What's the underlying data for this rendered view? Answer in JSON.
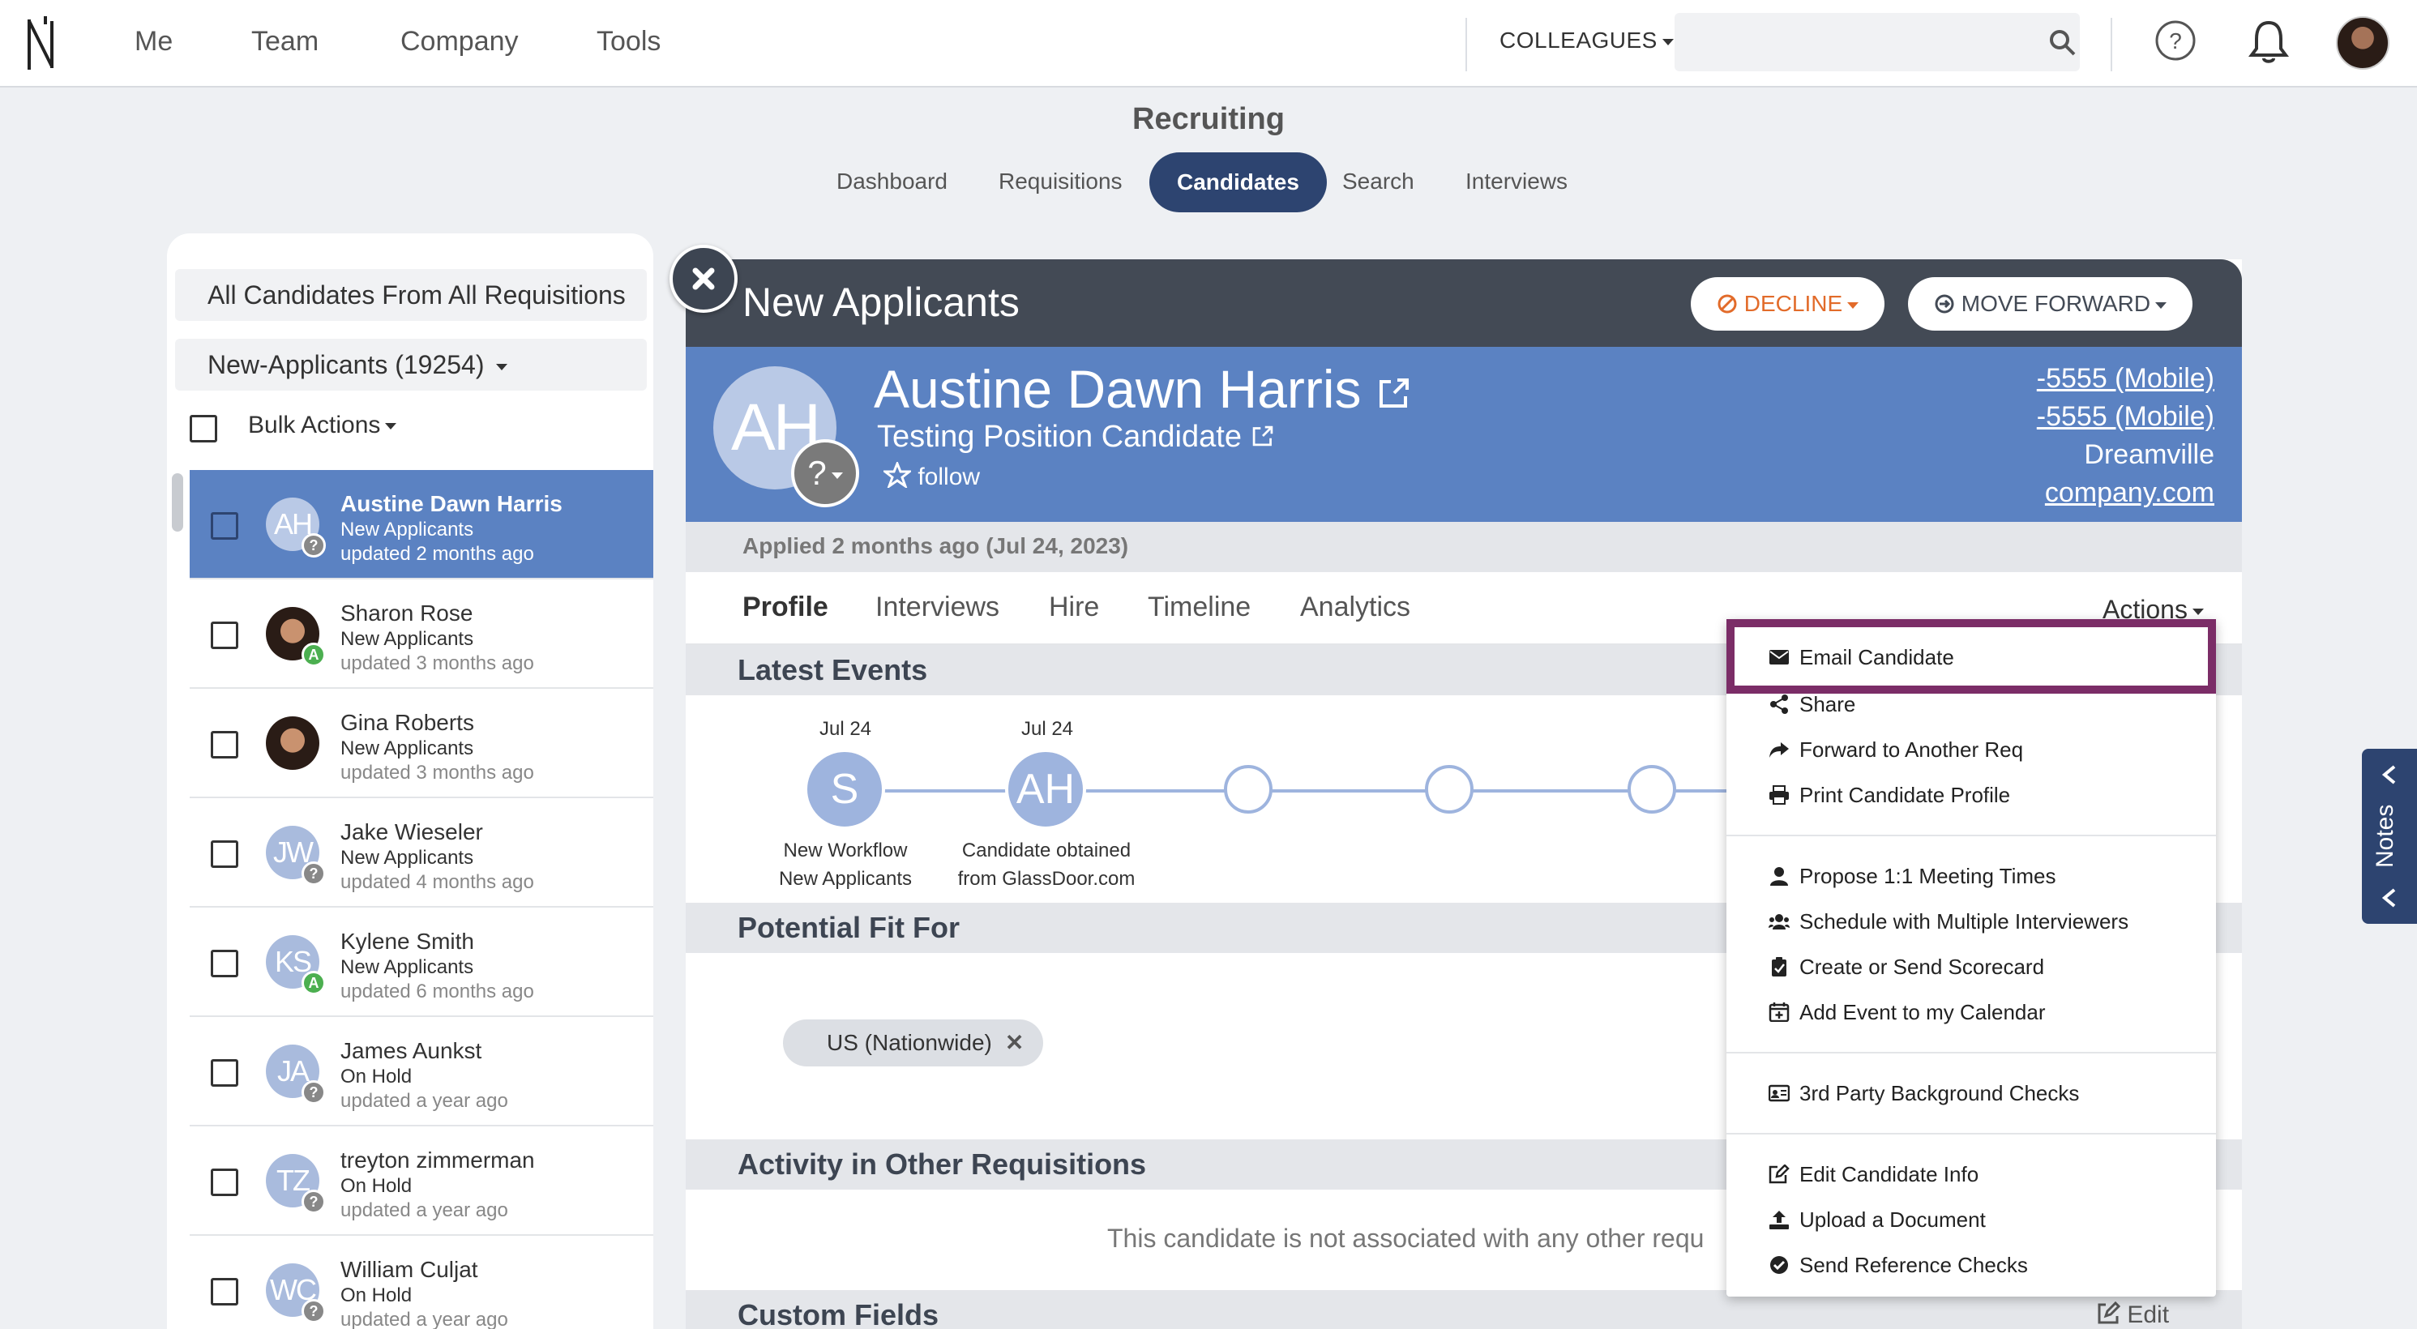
{
  "topnav": {
    "items": [
      "Me",
      "Team",
      "Company",
      "Tools"
    ],
    "colleagues_label": "COLLEAGUES",
    "search_placeholder": ""
  },
  "recruiting": {
    "title": "Recruiting",
    "tabs": [
      "Dashboard",
      "Requisitions",
      "Candidates",
      "Search",
      "Interviews"
    ],
    "active_tab": "Candidates"
  },
  "left": {
    "filter_scope": "All Candidates From All Requisitions",
    "filter_stage": "New-Applicants (19254)",
    "bulk_actions": "Bulk Actions",
    "candidates": [
      {
        "initials": "AH",
        "name": "Austine Dawn Harris",
        "stage": "New Applicants",
        "updated": "updated 2 months ago",
        "badge": "?"
      },
      {
        "initials": "",
        "name": "Sharon Rose",
        "stage": "New Applicants",
        "updated": "updated 3 months ago",
        "badge": "A"
      },
      {
        "initials": "",
        "name": "Gina Roberts",
        "stage": "New Applicants",
        "updated": "updated 3 months ago",
        "badge": ""
      },
      {
        "initials": "JW",
        "name": "Jake Wieseler",
        "stage": "New Applicants",
        "updated": "updated 4 months ago",
        "badge": "?"
      },
      {
        "initials": "KS",
        "name": "Kylene Smith",
        "stage": "New Applicants",
        "updated": "updated 6 months ago",
        "badge": "A"
      },
      {
        "initials": "JA",
        "name": "James Aunkst",
        "stage": "On Hold",
        "updated": "updated a year ago",
        "badge": "?"
      },
      {
        "initials": "TZ",
        "name": "treyton zimmerman",
        "stage": "On Hold",
        "updated": "updated a year ago",
        "badge": "?"
      },
      {
        "initials": "WC",
        "name": "William Culjat",
        "stage": "On Hold",
        "updated": "updated a year ago",
        "badge": "?"
      }
    ]
  },
  "main": {
    "header_title": "New Applicants",
    "decline_label": "DECLINE",
    "move_forward_label": "MOVE FORWARD",
    "candidate": {
      "initials": "AH",
      "badge": "?",
      "name": "Austine Dawn Harris",
      "position": "Testing Position Candidate",
      "follow": "follow",
      "phone1": "-5555 (Mobile)",
      "phone2": "-5555 (Mobile)",
      "city": "Dreamville",
      "website": "company.com"
    },
    "applied": "Applied 2 months ago (Jul 24, 2023)",
    "tabs": [
      "Profile",
      "Interviews",
      "Hire",
      "Timeline",
      "Analytics"
    ],
    "active_tab": "Profile",
    "actions_label": "Actions",
    "latest_events_title": "Latest Events",
    "events": [
      {
        "date": "Jul 24",
        "initials": "S",
        "line1": "New Workflow",
        "line2": "New Applicants"
      },
      {
        "date": "Jul 24",
        "initials": "AH",
        "line1": "Candidate obtained",
        "line2": "from GlassDoor.com"
      }
    ],
    "potential_fit_title": "Potential Fit For",
    "potential_fit_chip": "US (Nationwide)",
    "activity_title": "Activity in Other Requisitions",
    "activity_text": "This candidate is not associated with any other requ",
    "custom_fields_title": "Custom Fields",
    "edit_label": "Edit"
  },
  "actions_menu": {
    "items": [
      {
        "label": "Email Candidate",
        "icon": "envelope-icon"
      },
      {
        "label": "Share",
        "icon": "share-icon"
      },
      {
        "label": "Forward to Another Req",
        "icon": "forward-arrow-icon"
      },
      {
        "label": "Print Candidate Profile",
        "icon": "printer-icon"
      },
      {
        "label": "Propose 1:1 Meeting Times",
        "icon": "person-icon"
      },
      {
        "label": "Schedule with Multiple Interviewers",
        "icon": "people-icon"
      },
      {
        "label": "Create or Send Scorecard",
        "icon": "clipboard-icon"
      },
      {
        "label": "Add Event to my Calendar",
        "icon": "calendar-plus-icon"
      },
      {
        "label": "3rd Party Background Checks",
        "icon": "id-card-icon"
      },
      {
        "label": "Edit Candidate Info",
        "icon": "edit-icon"
      },
      {
        "label": "Upload a Document",
        "icon": "upload-icon"
      },
      {
        "label": "Send Reference Checks",
        "icon": "check-circle-icon"
      }
    ]
  },
  "notes_label": "Notes",
  "colors": {
    "brand_dark": "#2d4470",
    "header_dark": "#434a55",
    "profile_blue": "#5b82c2",
    "decline_orange": "#e26b2a",
    "highlight": "#7b2d67"
  }
}
